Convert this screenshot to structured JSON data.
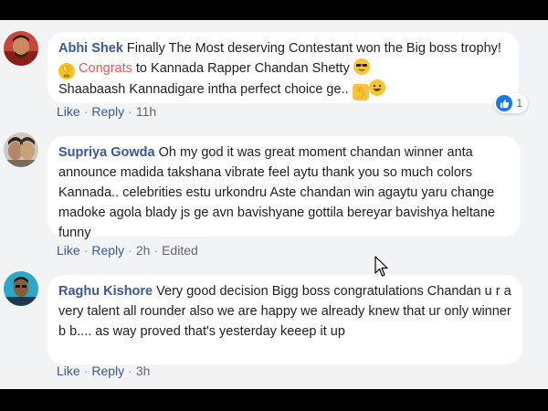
{
  "comments": [
    {
      "author": "Abhi Shek",
      "text_1": " Finally The Most deserving Contestant won the Big boss trophy!",
      "highlight": "Congrats",
      "text_2": " to Kannada Rapper Chandan Shetty ",
      "text_3": " Shaabaash Kannadigare intha perfect choice ge.. ",
      "emojis": [
        "trophy-icon",
        "sunglasses-face-icon",
        "clapping-hands-icon",
        "smiling-face-icon"
      ],
      "actions": {
        "like": "Like",
        "reply": "Reply",
        "time": "11h"
      },
      "reaction": {
        "count": "1",
        "type": "like"
      }
    },
    {
      "author": "Supriya Gowda",
      "text": " Oh my god it was great moment chandan winner anta announce madida takshana vibrate feel aytu thank you so much colors Kannada.. celebrities estu urkondru Aste chandan win agaytu yaru change madoke agola blady js ge avn bavishyane gottila bereyar bavishya heltane funny",
      "actions": {
        "like": "Like",
        "reply": "Reply",
        "time": "2h",
        "edited": "Edited"
      }
    },
    {
      "author": "Raghu Kishore",
      "text": " Very good decision Bigg boss congratulations Chandan u r a very talent all rounder also we are happy we already knew that ur only winner b b.... as way proved that's yesterday keeep it up",
      "actions": {
        "like": "Like",
        "reply": "Reply",
        "time": "3h"
      }
    }
  ],
  "colors": {
    "author": "#385898",
    "highlight": "#e8574f",
    "like_blue": "#1877f2",
    "background": "#f2f3f5"
  }
}
